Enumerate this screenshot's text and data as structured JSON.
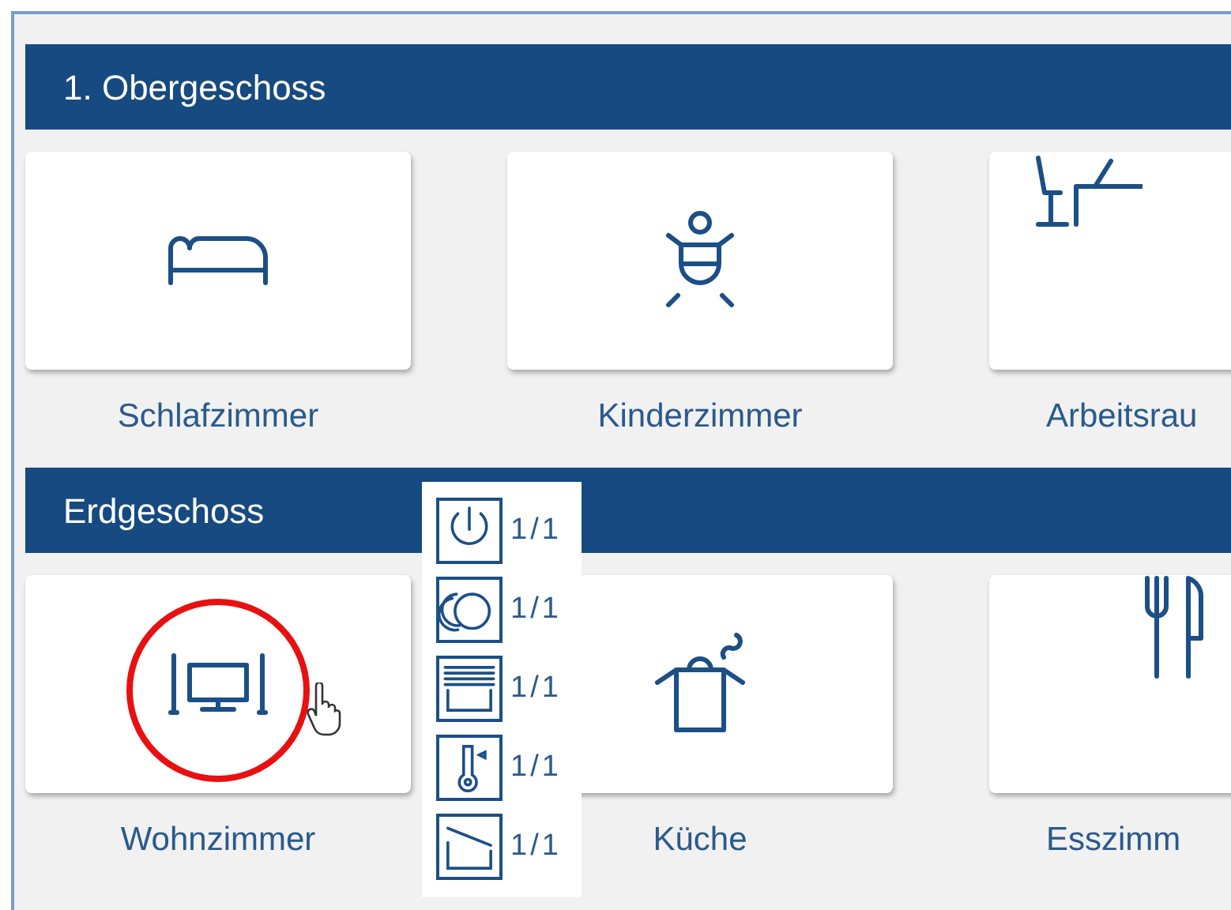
{
  "sections": [
    {
      "title": "1. Obergeschoss",
      "rooms": [
        {
          "name": "Schlafzimmer",
          "kind": "bed"
        },
        {
          "name": "Kinderzimmer",
          "kind": "child"
        },
        {
          "name": "Arbeitsrau",
          "kind": "desk"
        }
      ]
    },
    {
      "title": "Erdgeschoss",
      "rooms": [
        {
          "name": "Wohnzimmer",
          "kind": "tv"
        },
        {
          "name": "Küche",
          "kind": "pot"
        },
        {
          "name": "Esszimm",
          "kind": "cutlery"
        }
      ]
    }
  ],
  "popup": {
    "items": [
      {
        "kind": "power",
        "count": "1/1"
      },
      {
        "kind": "dial",
        "count": "1/1"
      },
      {
        "kind": "blind",
        "count": "1/1"
      },
      {
        "kind": "thermo",
        "count": "1/1"
      },
      {
        "kind": "window",
        "count": "1/1"
      }
    ]
  }
}
